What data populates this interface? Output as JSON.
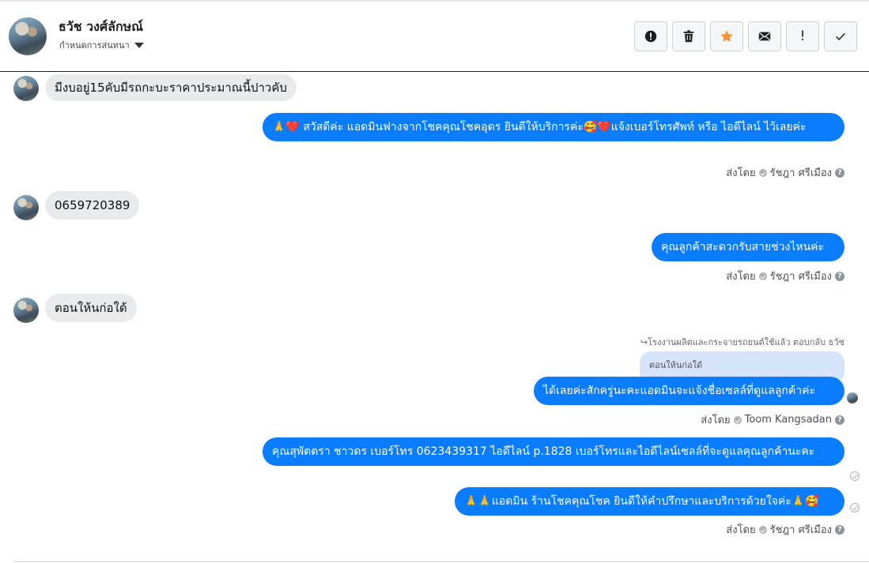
{
  "header": {
    "name": "ธวัช วงศ์ลักษณ์",
    "subtitle": "กำหนดการสนทนา",
    "actions": [
      {
        "icon": "alert-circle-icon"
      },
      {
        "icon": "trash-icon"
      },
      {
        "icon": "star-icon",
        "color": "#f7923b"
      },
      {
        "icon": "envelope-icon"
      },
      {
        "icon": "exclamation-icon",
        "text": "!"
      },
      {
        "icon": "check-icon"
      }
    ]
  },
  "messages": {
    "m1": "มีงบอยู่15คับมีรถกะบะราคาประมาณนี้ปาวคับ",
    "m2": "🙏❤️ สวัสดีค่ะ แอดมินฟางจากโชคคุณโชคอุดร ยินดีให้บริการค่ะ🥰❤️แจ้งเบอร์โทรศัพท์ หรือ ไอดีไลน์  ไว้เลยค่ะ",
    "m3": "0659720389",
    "m4": "คุณลูกค้าสะดวกรับสายช่วงไหนค่ะ",
    "m5": "ตอนให้นก่อใด้",
    "reply_note": "↪โรงงานผลิตและกระจายรถยนต์ใช้แล้ว ตอบกลับ ธวัช",
    "quoted": "ตอนให้นก่อใด้",
    "m6": "ได้เลยค่ะสักครู่นะคะแอดมินจะแจ้งชื่อเซลล์ที่ดูแลลูกค้าค่ะ",
    "m7": "คุณสุพัตตรา   ชาวดร      เบอร์โทร 0623439317  ไอดีไลน์ p.1828   เบอร์โทรและไอดีไลน์เซลล์ที่จะดูแลคุณลูกค้านะคะ",
    "m8": "🙏🙏แอดมิน ร้านโชคคุณโชค ยินดีให้คำปรึกษาและบริการด้วยใจค่ะ🙏🥰"
  },
  "sentby": {
    "label": "ส่งโดย",
    "s1": "รัชฎา ศรีเมือง",
    "s2": "รัชฎา ศรีเมือง",
    "s3": "Toom Kangsadan",
    "s4": "รัชฎา ศรีเมือง"
  },
  "colors": {
    "outgoing": "#0a7cff",
    "incoming": "#e9eaec",
    "quoted": "#d5e4fb"
  }
}
